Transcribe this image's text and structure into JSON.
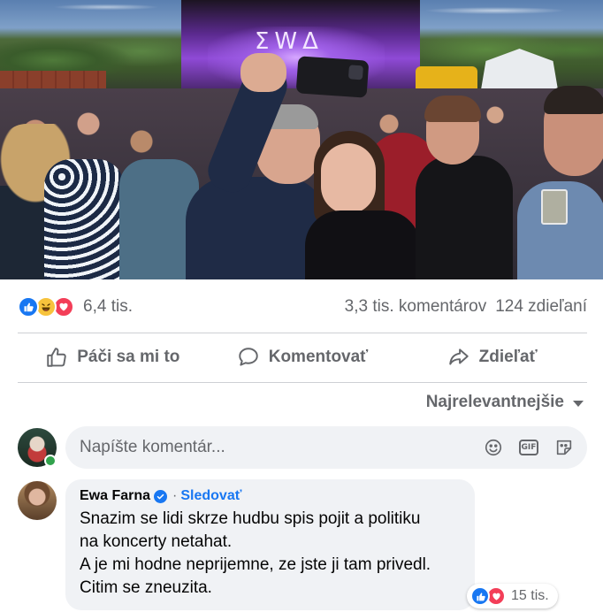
{
  "photo": {
    "stage_logo": "ΣWΔ"
  },
  "reactions": {
    "icons": [
      "like-reaction",
      "haha-reaction",
      "love-reaction"
    ],
    "count": "6,4 tis.",
    "comments": "3,3 tis. komentárov",
    "shares": "124 zdieľaní"
  },
  "actions": {
    "like": "Páči sa mi to",
    "comment": "Komentovať",
    "share": "Zdieľať"
  },
  "sort": {
    "label": "Najrelevantnejšie"
  },
  "composer": {
    "placeholder": "Napíšte komentár...",
    "icons": [
      "emoji-icon",
      "gif-icon",
      "sticker-icon"
    ],
    "gif_label": "GIF"
  },
  "comment": {
    "author": "Ewa Farna",
    "separator": "·",
    "follow": "Sledovať",
    "lines": [
      "Snazim se lidi skrze hudbu spis pojit a politiku",
      "na koncerty netahat.",
      "A je mi hodne neprijemne, ze jste ji tam privedl.",
      "Citim se zneuzita."
    ],
    "reaction_count": "15 tis."
  },
  "colors": {
    "like": "#1877f2",
    "love": "#f33e58",
    "haha": "#f7c33c",
    "online": "#31a24c",
    "muted_text": "#65676b",
    "bubble": "#f0f2f5"
  }
}
